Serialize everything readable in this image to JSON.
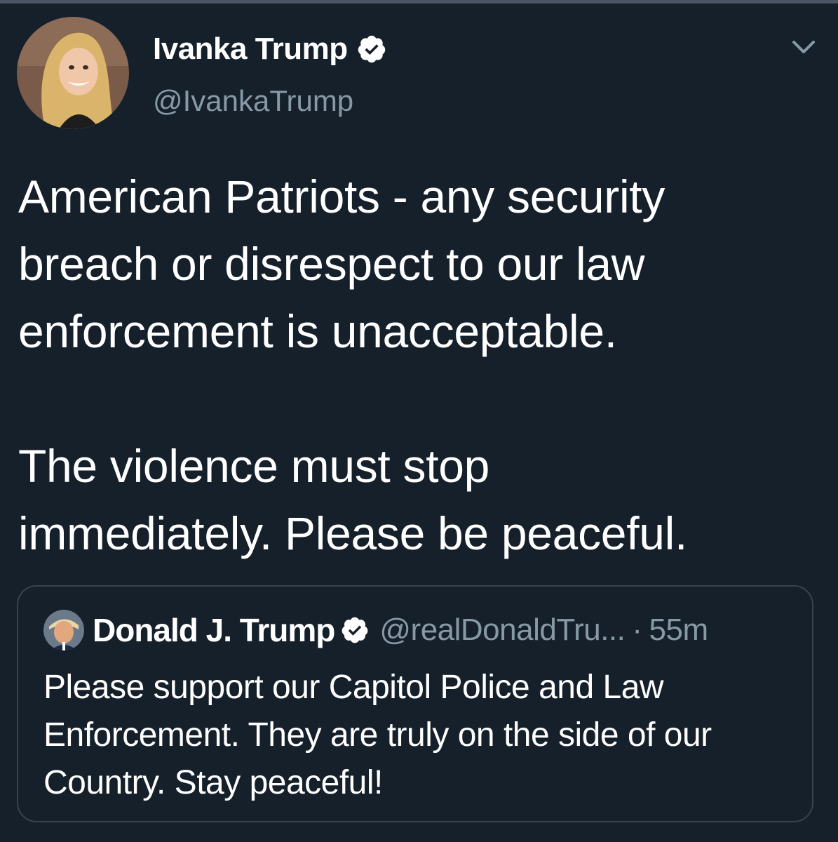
{
  "author": {
    "display_name": "Ivanka Trump",
    "handle": "@IvankaTrump",
    "verified_icon": "verified-badge-icon",
    "menu_icon": "chevron-down-icon"
  },
  "tweet": {
    "text": "American Patriots - any security\nbreach or disrespect to our law\nenforcement is unacceptable.\n\nThe violence must stop\nimmediately. Please be peaceful."
  },
  "quoted_tweet": {
    "display_name": "Donald J. Trump",
    "handle": "@realDonaldTru...",
    "separator": "·",
    "time": "55m",
    "text": "Please support our Capitol Police and Law\nEnforcement. They are truly on the side of our\nCountry. Stay peaceful!"
  },
  "colors": {
    "background": "#15202b",
    "text": "#ffffff",
    "secondary_text": "#8899a6",
    "border": "#38444d"
  }
}
